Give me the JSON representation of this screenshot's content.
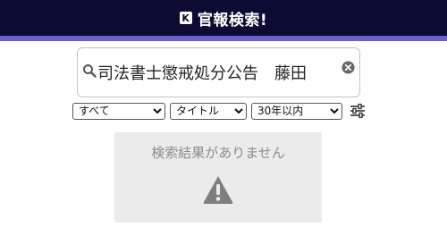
{
  "header": {
    "logo_letter": "K",
    "title": "官報検索!",
    "bar_color": "#0b0b33",
    "accent_color": "#6b5fc4"
  },
  "search": {
    "value": "司法書士懲戒処分公告　藤田",
    "placeholder": "",
    "icon": "search-icon",
    "clear_icon": "clear-icon"
  },
  "filters": {
    "category": {
      "selected": "すべて",
      "options": [
        "すべて"
      ]
    },
    "field": {
      "selected": "タイトル",
      "options": [
        "タイトル"
      ]
    },
    "range": {
      "selected": "30年以内",
      "options": [
        "30年以内"
      ]
    },
    "settings_icon": "sliders-icon"
  },
  "result": {
    "message": "検索結果がありません",
    "icon": "warning-icon"
  }
}
